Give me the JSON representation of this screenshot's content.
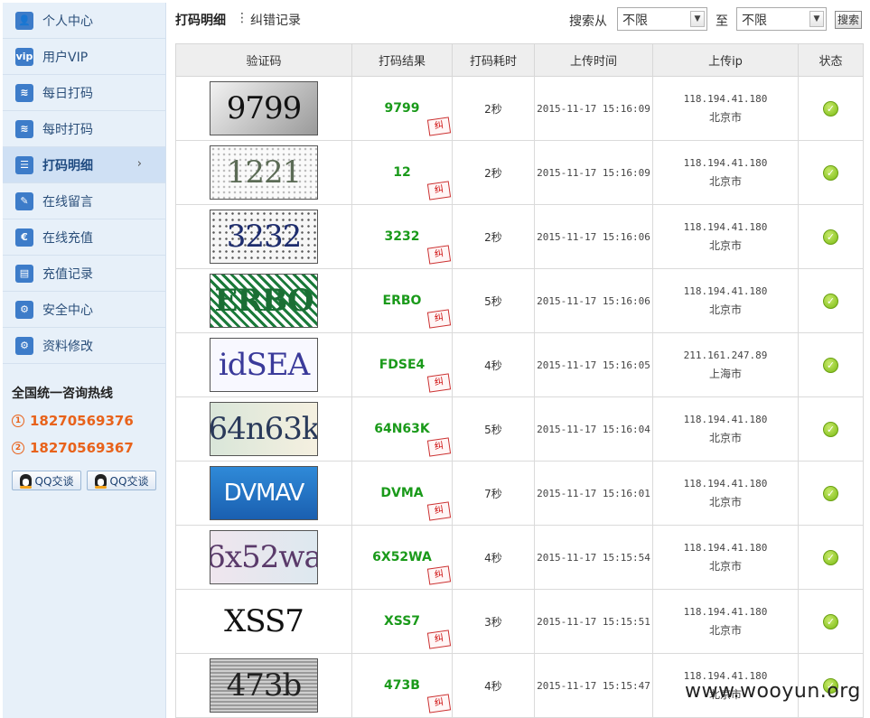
{
  "sidebar": {
    "items": [
      {
        "label": "个人中心",
        "icon": "user-icon",
        "glyph": "👤"
      },
      {
        "label": "用户VIP",
        "icon": "vip-icon",
        "glyph": "vip"
      },
      {
        "label": "每日打码",
        "icon": "rss-icon",
        "glyph": "≋"
      },
      {
        "label": "每时打码",
        "icon": "rss-icon",
        "glyph": "≋"
      },
      {
        "label": "打码明细",
        "icon": "list-icon",
        "glyph": "☰",
        "active": true
      },
      {
        "label": "在线留言",
        "icon": "edit-icon",
        "glyph": "✎"
      },
      {
        "label": "在线充值",
        "icon": "euro-icon",
        "glyph": "€"
      },
      {
        "label": "充值记录",
        "icon": "calendar-icon",
        "glyph": "▤"
      },
      {
        "label": "安全中心",
        "icon": "gear-icon",
        "glyph": "⚙"
      },
      {
        "label": "资料修改",
        "icon": "gear-icon",
        "glyph": "⚙"
      }
    ],
    "hotline_title": "全国统一咨询热线",
    "phones": [
      "18270569376",
      "18270569367"
    ],
    "phone_marks": [
      "1",
      "2"
    ],
    "qq_label": "QQ交谈"
  },
  "header": {
    "tab_main": "打码明细",
    "separator": "⋮",
    "tab_second": "纠错记录",
    "search_from": "搜索从",
    "from_value": "不限",
    "to_label": "至",
    "to_value": "不限",
    "search_button": "搜索"
  },
  "table": {
    "columns": [
      "验证码",
      "打码结果",
      "打码耗时",
      "上传时间",
      "上传ip",
      "状态"
    ],
    "fix_label": "纠",
    "rows": [
      {
        "captcha": "9799",
        "result": "9799",
        "cost": "2秒",
        "time": "2015-11-17 15:16:09",
        "ip": "118.194.41.180",
        "city": "北京市"
      },
      {
        "captcha": "1221",
        "result": "12",
        "cost": "2秒",
        "time": "2015-11-17 15:16:09",
        "ip": "118.194.41.180",
        "city": "北京市"
      },
      {
        "captcha": "3232",
        "result": "3232",
        "cost": "2秒",
        "time": "2015-11-17 15:16:06",
        "ip": "118.194.41.180",
        "city": "北京市"
      },
      {
        "captcha": "ERBO",
        "result": "ERBO",
        "cost": "5秒",
        "time": "2015-11-17 15:16:06",
        "ip": "118.194.41.180",
        "city": "北京市"
      },
      {
        "captcha": "idSEA",
        "result": "FDSE4",
        "cost": "4秒",
        "time": "2015-11-17 15:16:05",
        "ip": "211.161.247.89",
        "city": "上海市"
      },
      {
        "captcha": "64n63k",
        "result": "64N63K",
        "cost": "5秒",
        "time": "2015-11-17 15:16:04",
        "ip": "118.194.41.180",
        "city": "北京市"
      },
      {
        "captcha": "DVMAV",
        "result": "DVMA",
        "cost": "7秒",
        "time": "2015-11-17 15:16:01",
        "ip": "118.194.41.180",
        "city": "北京市"
      },
      {
        "captcha": "6x52wa",
        "result": "6X52WA",
        "cost": "4秒",
        "time": "2015-11-17 15:15:54",
        "ip": "118.194.41.180",
        "city": "北京市"
      },
      {
        "captcha": "XSS7",
        "result": "XSS7",
        "cost": "3秒",
        "time": "2015-11-17 15:15:51",
        "ip": "118.194.41.180",
        "city": "北京市"
      },
      {
        "captcha": "473b",
        "result": "473B",
        "cost": "4秒",
        "time": "2015-11-17 15:15:47",
        "ip": "118.194.41.180",
        "city": "北京市"
      }
    ]
  },
  "watermark": "www.wooyun.org",
  "colors": {
    "accent": "#3d7cc9",
    "phone": "#e8621a",
    "result": "#1a9a1a"
  }
}
